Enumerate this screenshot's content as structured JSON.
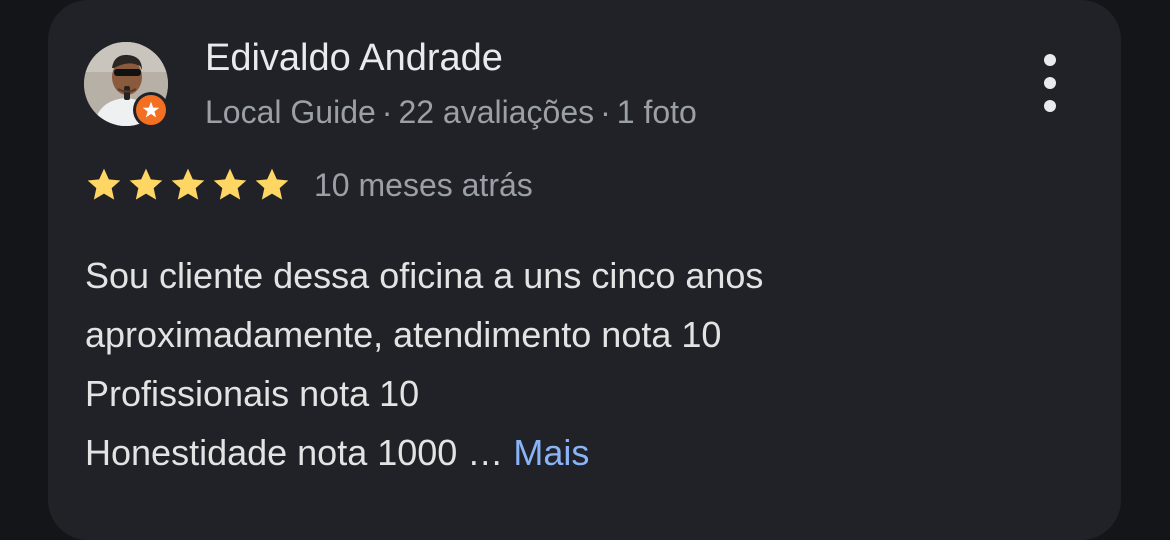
{
  "review": {
    "author": {
      "name": "Edivaldo Andrade",
      "badge": "Local Guide",
      "reviews_count": "22 avaliações",
      "photos_count": "1 foto",
      "separator": "·",
      "avatar_icon": "person-avatar",
      "badge_icon": "local-guide-star-icon"
    },
    "rating": 5,
    "rating_max": 5,
    "star_color": "#fdd663",
    "date": "10 meses atrás",
    "text_lines": [
      "Sou cliente dessa oficina a uns cinco anos",
      "aproximadamente, atendimento nota 10",
      "Profissionais nota 10",
      "Honestidade nota 1000 …"
    ],
    "more_label": "Mais",
    "menu_icon": "more-vert-icon"
  },
  "colors": {
    "background": "#141518",
    "card": "#202227",
    "link": "#8ab4f8",
    "badge": "#f36f21"
  }
}
